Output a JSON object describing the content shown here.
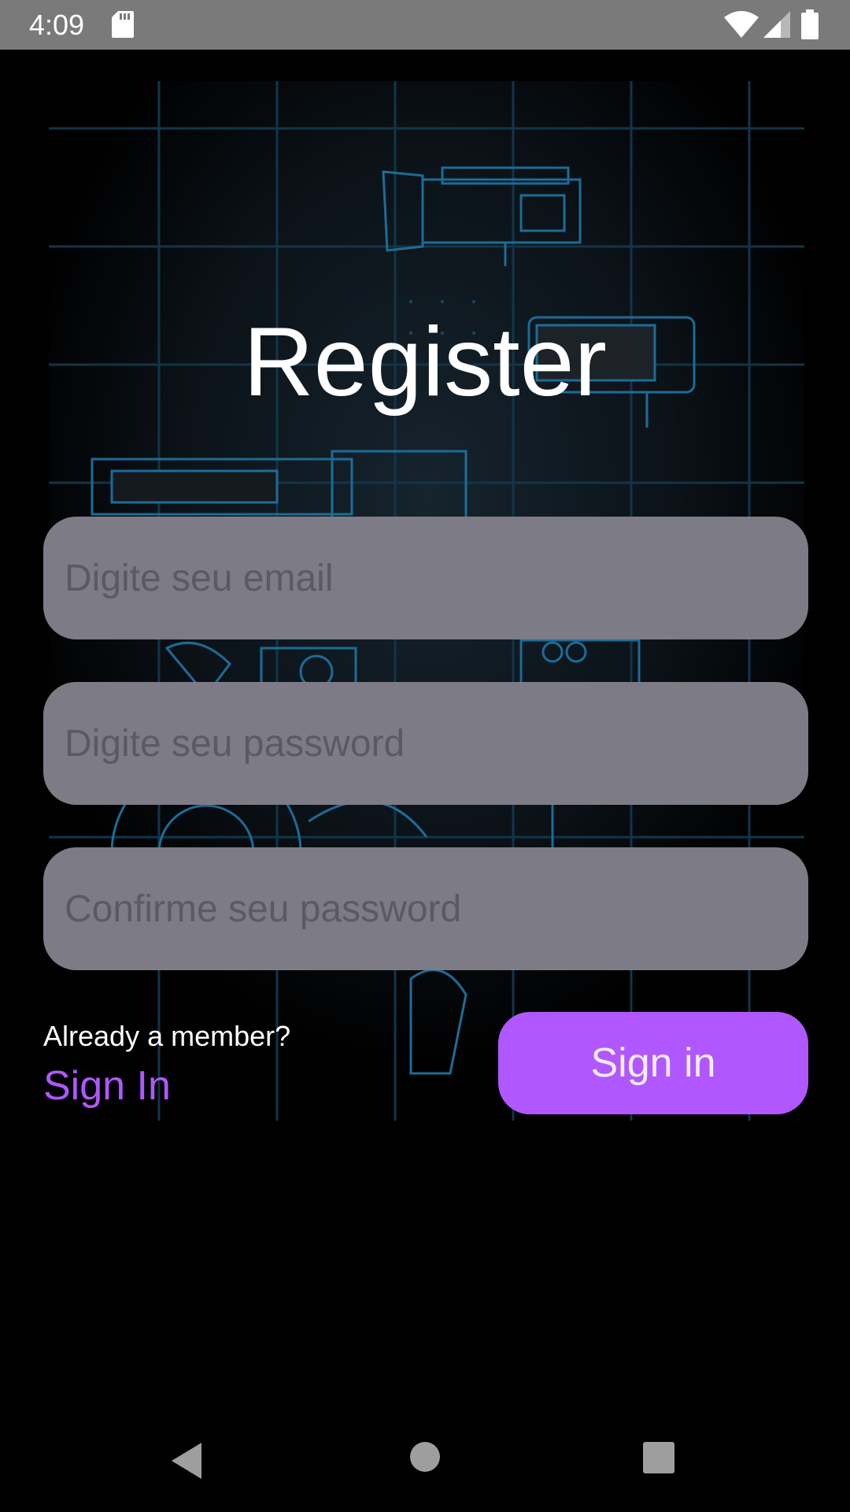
{
  "status_bar": {
    "time": "4:09",
    "icons": [
      "sd-card-icon",
      "wifi-icon",
      "signal-icon",
      "battery-icon"
    ]
  },
  "background": {
    "description_icon": "blueprint-background-icon",
    "accent_color": "#1a6a9a"
  },
  "register": {
    "title": "Register",
    "email_placeholder": "Digite seu email",
    "password_placeholder": "Digite seu password",
    "confirm_placeholder": "Confirme seu password",
    "member_prompt": "Already a member?",
    "sign_in_link": "Sign In",
    "sign_in_button": "Sign in"
  },
  "colors": {
    "accent": "#b057ff",
    "input_bg": "#7d7c86",
    "status_bar": "#7a7a7a"
  },
  "nav_bar": {
    "icons": [
      "back-icon",
      "home-icon",
      "recents-icon"
    ]
  }
}
